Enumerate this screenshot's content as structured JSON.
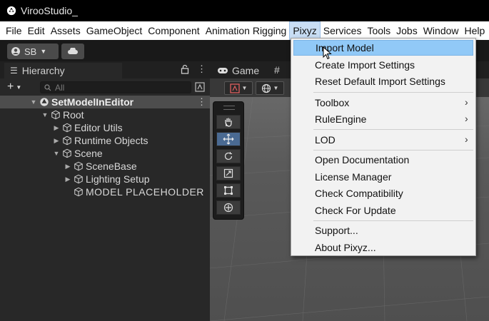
{
  "window": {
    "title": "VirooStudio_"
  },
  "menubar": {
    "items": [
      "File",
      "Edit",
      "Assets",
      "GameObject",
      "Component",
      "Animation Rigging",
      "Pixyz",
      "Services",
      "Tools",
      "Jobs",
      "Window",
      "Help"
    ],
    "active": "Pixyz"
  },
  "toolbar": {
    "account_label": "SB"
  },
  "hierarchy": {
    "tab_label": "Hierarchy",
    "add_label": "+",
    "search_placeholder": "All",
    "rows": [
      {
        "label": "SetModelInEditor",
        "depth": 0,
        "expanded": true,
        "selected": true
      },
      {
        "label": "Root",
        "depth": 1,
        "expanded": true
      },
      {
        "label": "Editor Utils",
        "depth": 2,
        "expanded": false
      },
      {
        "label": "Runtime Objects",
        "depth": 2,
        "expanded": false
      },
      {
        "label": "Scene",
        "depth": 2,
        "expanded": true
      },
      {
        "label": "SceneBase",
        "depth": 3,
        "expanded": false
      },
      {
        "label": "Lighting Setup",
        "depth": 3,
        "expanded": false
      },
      {
        "label": "MODEL PLACEHOLDER",
        "depth": 3,
        "leaf": true
      }
    ]
  },
  "gameview": {
    "tab_label": "Game",
    "tab2_label": "#"
  },
  "dropdown": {
    "items": [
      {
        "label": "Import Model",
        "hover": true
      },
      {
        "label": "Create Import Settings"
      },
      {
        "label": "Reset Default Import Settings"
      },
      {
        "label": "Toolbox",
        "submenu": true
      },
      {
        "label": "RuleEngine",
        "submenu": true
      },
      {
        "label": "LOD",
        "submenu": true
      },
      {
        "label": "Open Documentation"
      },
      {
        "label": "License Manager"
      },
      {
        "label": "Check Compatibility"
      },
      {
        "label": "Check For Update"
      },
      {
        "label": "Support..."
      },
      {
        "label": "About Pixyz..."
      }
    ]
  },
  "icons": {
    "unity_logo": "unity-logo-icon",
    "lock": "lock-icon",
    "more": "kebab-menu-icon",
    "search": "search-icon",
    "gameobject": "cube-icon",
    "scene": "unity-scene-icon",
    "cloud": "cloud-icon",
    "account": "account-icon",
    "hand": "hand-tool-icon",
    "move": "move-tool-icon",
    "rotate": "rotate-tool-icon",
    "scale": "scale-tool-icon",
    "rect": "rect-tool-icon",
    "transform": "transform-tool-icon",
    "cursor": "mouse-cursor-icon",
    "submenu": "chevron-right-icon"
  },
  "colors": {
    "titlebar": "#000000",
    "menubar": "#ffffff",
    "panel": "#282828",
    "selected_row": "#4d4d4d",
    "menu_hover": "#91c9f7",
    "active_tool": "#4a6a92"
  }
}
